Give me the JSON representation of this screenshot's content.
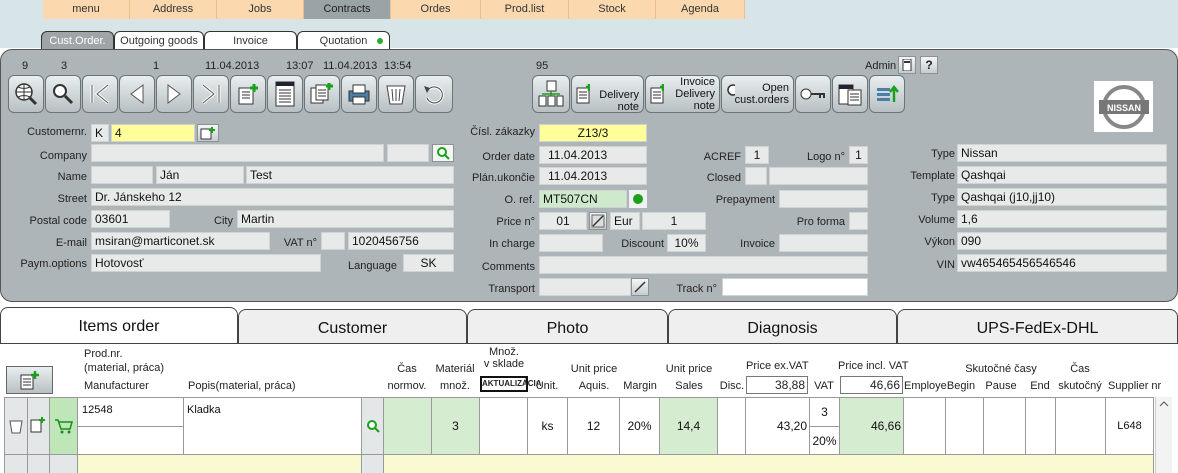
{
  "top_menu": [
    "menu",
    "Address",
    "Jobs",
    "Contracts",
    "Ordes",
    "Prod.list",
    "Stock",
    "Agenda"
  ],
  "sub_tabs": [
    "Cust.Order.",
    "Outgoing goods",
    "Invoice",
    "Quotation"
  ],
  "toolbar": {
    "counter_left": "9",
    "counter_left2": "3",
    "counter_mid": "1",
    "date1": "11.04.2013",
    "time1": "13:07",
    "date2": "11.04.2013",
    "time2": "13:54",
    "counter_right": "95",
    "delivery_note": "Delivery note",
    "invoice_delivery_note_1": "Invoice",
    "invoice_delivery_note_2": "Delivery note",
    "open_orders_1": "Open",
    "open_orders_2": "cust.orders",
    "user": "Admin"
  },
  "customer": {
    "customernr_label": "Customernr.",
    "customernr_prefix": "K",
    "customernr": "4",
    "company_label": "Company",
    "company": "",
    "name_label": "Name",
    "first_name": "Ján",
    "last_name": "Test",
    "street_label": "Street",
    "street": "Dr. Jánskeho 12",
    "postal_label": "Postal code",
    "postal": "03601",
    "city_label": "City",
    "city": "Martin",
    "email_label": "E-mail",
    "email": "msiran@marticonet.sk",
    "vat_label": "VAT n°",
    "vat": "1020456756",
    "paym_label": "Paym.options",
    "paym": "Hotovosť",
    "language_label": "Language",
    "language": "SK"
  },
  "order": {
    "zakazky_label": "Čísl. zákazky",
    "zakazky": "Z13/3",
    "order_date_label": "Order date",
    "order_date": "11.04.2013",
    "plan_label": "Plán.ukončie",
    "plan": "11.04.2013",
    "oref_label": "O. ref.",
    "oref": "MT507CN",
    "price_label": "Price n°",
    "price_no": "01",
    "currency": "Eur",
    "rate": "1",
    "incharge_label": "In charge",
    "discount_label": "Discount",
    "discount": "10%",
    "invoice_label": "Invoice",
    "comments_label": "Comments",
    "transport_label": "Transport",
    "track_label": "Track n°",
    "acref_label": "ACREF",
    "acref": "1",
    "logo_label": "Logo n°",
    "logo": "1",
    "closed_label": "Closed",
    "prepayment_label": "Prepayment",
    "proforma_label": "Pro forma"
  },
  "vehicle": {
    "brand_logo": "NISSAN",
    "type_label": "Type",
    "type": "Nissan",
    "template_label": "Template",
    "template": "Qashqai",
    "type2_label": "Type",
    "type2": "Qashqai (j10,jj10)",
    "volume_label": "Volume",
    "volume": "1,6",
    "vykon_label": "Výkon",
    "vykon": "090",
    "vin_label": "VIN",
    "vin": "vw465465456546546"
  },
  "bottom_tabs": [
    "Items order",
    "Customer",
    "Photo",
    "Diagnosis",
    "UPS-FedEx-DHL"
  ],
  "grid_headers": {
    "prodnr": "Prod.nr.",
    "prodnr2": "(material, práca)",
    "manufacturer": "Manufacturer",
    "popis": "Popis(material, práca)",
    "cas": "Čas",
    "cas2": "normov.",
    "material": "Materiál",
    "material2": "množ.",
    "mnoz": "Množ.",
    "mnoz2": "v sklade",
    "aktualizacia": "AKTUALIZÁCIA",
    "unit": "Unit.",
    "unit_price": "Unit price",
    "aquis": "Aquis.",
    "margin": "Margin",
    "unit_price2": "Unit price",
    "sales": "Sales",
    "disc": "Disc.",
    "price_ex": "Price ex.VAT",
    "price_ex_total": "38,88",
    "vat": "VAT",
    "price_incl": "Price incl. VAT",
    "price_incl_total": "46,66",
    "employe": "Employe",
    "skutocne": "Skutočné časy",
    "begin": "Begin",
    "pause": "Pause",
    "end": "End",
    "cas_skut": "Čas",
    "cas_skut2": "skutočný",
    "supplier": "Supplier nr"
  },
  "row": {
    "prodnr": "12548",
    "popis": "Kladka",
    "material": "3",
    "unit": "ks",
    "aquis": "12",
    "margin": "20%",
    "sales": "14,4",
    "price_ex": "43,20",
    "vat_rate": "3",
    "vat_pct": "20%",
    "price_incl": "46,66",
    "supplier": "L648"
  }
}
